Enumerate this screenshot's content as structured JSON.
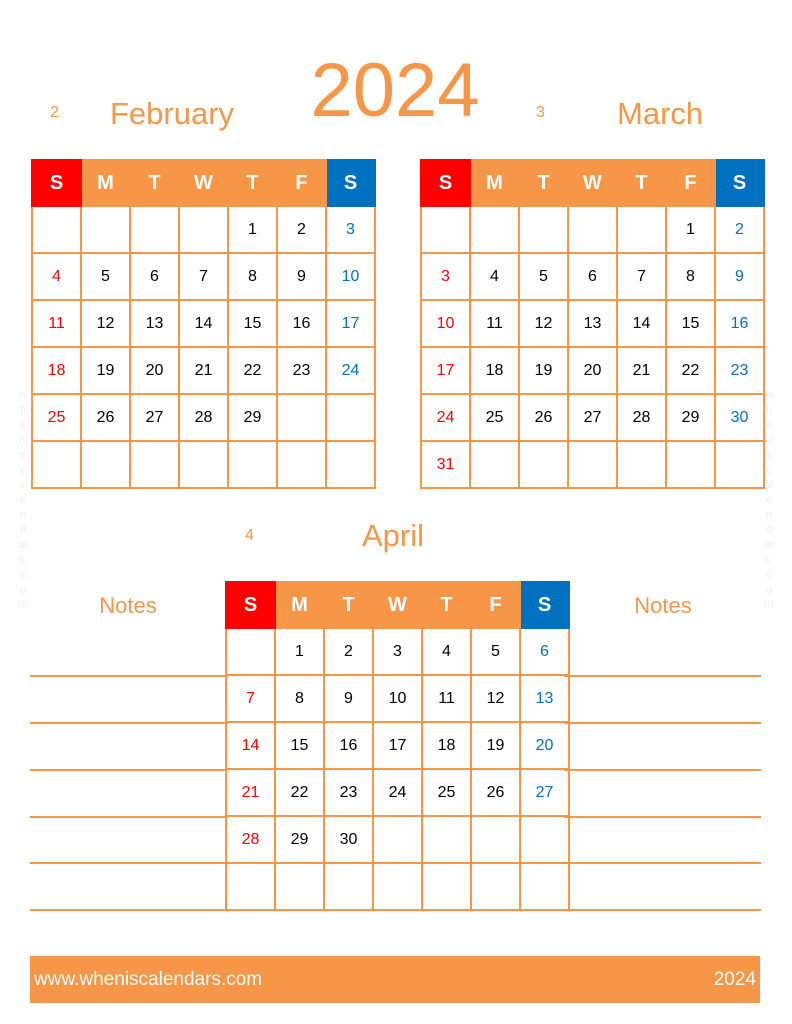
{
  "year": "2024",
  "weekday_headers": [
    "S",
    "M",
    "T",
    "W",
    "T",
    "F",
    "S"
  ],
  "months": [
    {
      "number": "2",
      "name": "February",
      "weeks": [
        [
          "",
          "",
          "",
          "",
          "1",
          "2",
          "3"
        ],
        [
          "4",
          "5",
          "6",
          "7",
          "8",
          "9",
          "10"
        ],
        [
          "11",
          "12",
          "13",
          "14",
          "15",
          "16",
          "17"
        ],
        [
          "18",
          "19",
          "20",
          "21",
          "22",
          "23",
          "24"
        ],
        [
          "25",
          "26",
          "27",
          "28",
          "29",
          "",
          ""
        ],
        [
          "",
          "",
          "",
          "",
          "",
          "",
          ""
        ]
      ]
    },
    {
      "number": "3",
      "name": "March",
      "weeks": [
        [
          "",
          "",
          "",
          "",
          "",
          "1",
          "2"
        ],
        [
          "3",
          "4",
          "5",
          "6",
          "7",
          "8",
          "9"
        ],
        [
          "10",
          "11",
          "12",
          "13",
          "14",
          "15",
          "16"
        ],
        [
          "17",
          "18",
          "19",
          "20",
          "21",
          "22",
          "23"
        ],
        [
          "24",
          "25",
          "26",
          "27",
          "28",
          "29",
          "30"
        ],
        [
          "31",
          "",
          "",
          "",
          "",
          "",
          ""
        ]
      ]
    },
    {
      "number": "4",
      "name": "April",
      "weeks": [
        [
          "",
          "1",
          "2",
          "3",
          "4",
          "5",
          "6"
        ],
        [
          "7",
          "8",
          "9",
          "10",
          "11",
          "12",
          "13"
        ],
        [
          "14",
          "15",
          "16",
          "17",
          "18",
          "19",
          "20"
        ],
        [
          "21",
          "22",
          "23",
          "24",
          "25",
          "26",
          "27"
        ],
        [
          "28",
          "29",
          "30",
          "",
          "",
          "",
          ""
        ],
        [
          "",
          "",
          "",
          "",
          "",
          "",
          ""
        ]
      ]
    }
  ],
  "notes": {
    "left_label": "Notes",
    "right_label": "Notes"
  },
  "watermark": "wheniscalendars.com",
  "footer": {
    "url": "www.wheniscalendars.com",
    "year": "2024"
  },
  "colors": {
    "accent": "#f79646",
    "sunday": "#ff0000",
    "saturday": "#0070c0"
  }
}
